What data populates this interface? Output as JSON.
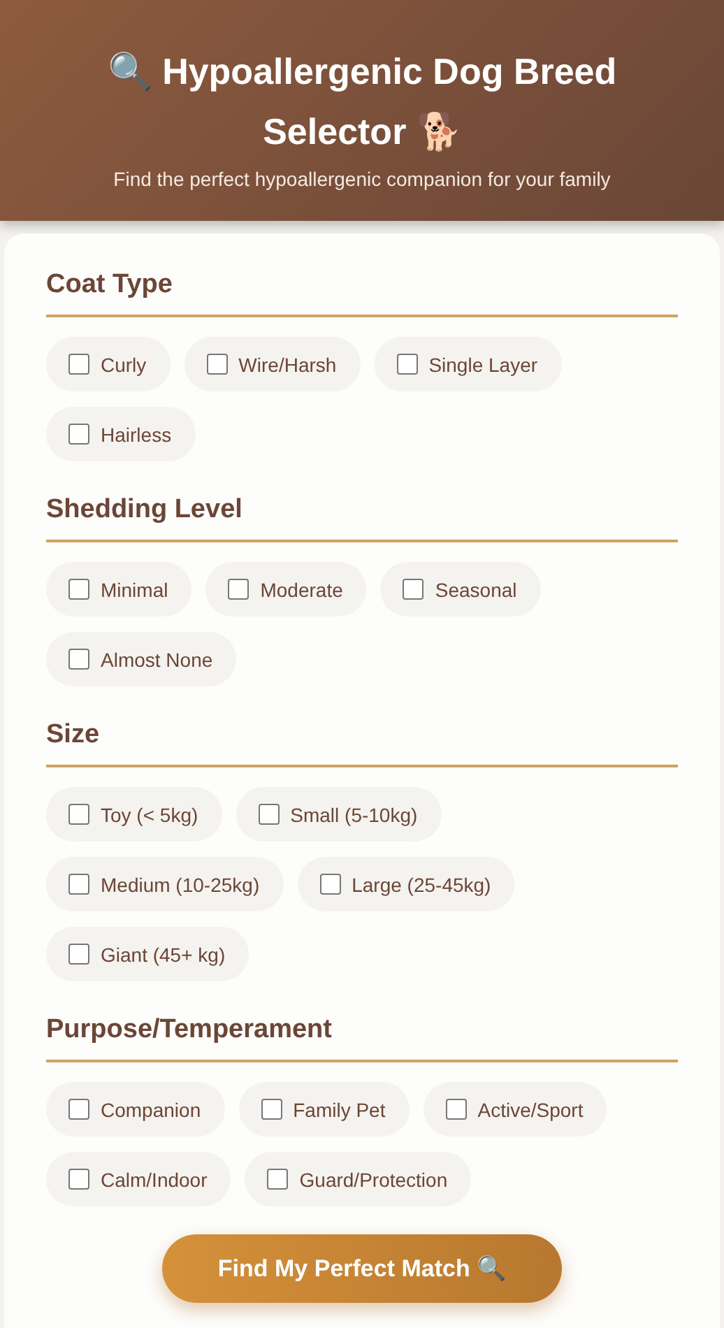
{
  "header": {
    "title": "🔍 Hypoallergenic Dog Breed Selector 🐕",
    "subtitle": "Find the perfect hypoallergenic companion for your family"
  },
  "sections": [
    {
      "title": "Coat Type",
      "options": [
        {
          "label": "Curly",
          "checked": false
        },
        {
          "label": "Wire/Harsh",
          "checked": false
        },
        {
          "label": "Single Layer",
          "checked": false
        },
        {
          "label": "Hairless",
          "checked": false
        }
      ]
    },
    {
      "title": "Shedding Level",
      "options": [
        {
          "label": "Minimal",
          "checked": false
        },
        {
          "label": "Moderate",
          "checked": false
        },
        {
          "label": "Seasonal",
          "checked": false
        },
        {
          "label": "Almost None",
          "checked": false
        }
      ]
    },
    {
      "title": "Size",
      "options": [
        {
          "label": "Toy (< 5kg)",
          "checked": false
        },
        {
          "label": "Small (5-10kg)",
          "checked": false
        },
        {
          "label": "Medium (10-25kg)",
          "checked": false
        },
        {
          "label": "Large (25-45kg)",
          "checked": false
        },
        {
          "label": "Giant (45+ kg)",
          "checked": false
        }
      ]
    },
    {
      "title": "Purpose/Temperament",
      "options": [
        {
          "label": "Companion",
          "checked": false
        },
        {
          "label": "Family Pet",
          "checked": false
        },
        {
          "label": "Active/Sport",
          "checked": false
        },
        {
          "label": "Calm/Indoor",
          "checked": false
        },
        {
          "label": "Guard/Protection",
          "checked": false
        }
      ]
    }
  ],
  "button": {
    "label": "Find My Perfect Match 🔍"
  }
}
